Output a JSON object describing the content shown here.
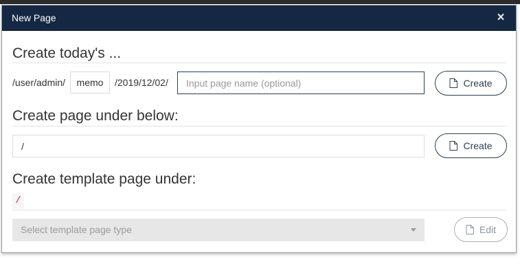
{
  "modal": {
    "title": "New Page",
    "close_label": "×"
  },
  "today": {
    "heading": "Create today's ...",
    "path_prefix": "/user/admin/",
    "memo": "memo",
    "date_path": "/2019/12/02/",
    "page_name_placeholder": "Input page name (optional)",
    "page_name_value": "",
    "create_label": "Create"
  },
  "under": {
    "heading": "Create page under below:",
    "path_value": "/",
    "create_label": "Create"
  },
  "template": {
    "heading": "Create template page under:",
    "path": "/",
    "select_placeholder": "Select template page type",
    "edit_label": "Edit"
  },
  "icons": {
    "create": "file-icon",
    "edit": "file-icon",
    "close": "close-icon",
    "select": "chevron-down-icon"
  },
  "colors": {
    "header_bg": "#142743",
    "accent": "#2c3e50",
    "code_text": "#c7254e"
  }
}
